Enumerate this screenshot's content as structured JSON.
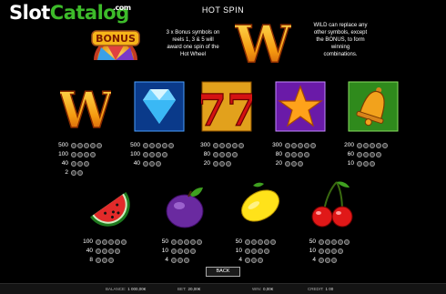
{
  "header": {
    "title": "HOT SPIN"
  },
  "logo": {
    "slot": "Slot",
    "catalog": "Catalog",
    "com": ".com"
  },
  "bonus": {
    "icon_text": "BONUS",
    "description_lines": [
      "3 x Bonus symbols on",
      "reels 1, 3 & 5 will",
      "award one spin of the",
      "Hot Wheel"
    ]
  },
  "wild": {
    "icon_text": "W",
    "description_lines": [
      "WILD can replace any",
      "other symbols, except",
      "the BONUS, to form",
      "winning",
      "combinations."
    ]
  },
  "paytable": {
    "row1": [
      {
        "symbol": "wild-w-icon",
        "payouts": [
          "500",
          "100",
          "40",
          "2"
        ]
      },
      {
        "symbol": "diamond-icon",
        "payouts": [
          "500",
          "100",
          "40"
        ]
      },
      {
        "symbol": "seven-icon",
        "payouts": [
          "300",
          "80",
          "20"
        ]
      },
      {
        "symbol": "star-icon",
        "payouts": [
          "300",
          "80",
          "20"
        ]
      },
      {
        "symbol": "bell-icon",
        "payouts": [
          "200",
          "60",
          "10"
        ]
      }
    ],
    "row2": [
      {
        "symbol": "watermelon-icon",
        "payouts": [
          "100",
          "40",
          "8"
        ]
      },
      {
        "symbol": "plum-icon",
        "payouts": [
          "50",
          "10",
          "4"
        ]
      },
      {
        "symbol": "lemon-icon",
        "payouts": [
          "50",
          "10",
          "4"
        ]
      },
      {
        "symbol": "cherry-icon",
        "payouts": [
          "50",
          "10",
          "4"
        ]
      }
    ]
  },
  "buttons": {
    "back": "BACK"
  },
  "status_bar": {
    "balance_label": "BALANCE:",
    "balance_value": "1 000,00€",
    "bet_label": "BET:",
    "bet_value": "20,00€",
    "win_label": "WIN:",
    "win_value": "0,00€",
    "credit_label": "CREDIT:",
    "credit_value": "1 00"
  },
  "colors": {
    "logo_green": "#3dbb2a",
    "background": "#000000"
  }
}
